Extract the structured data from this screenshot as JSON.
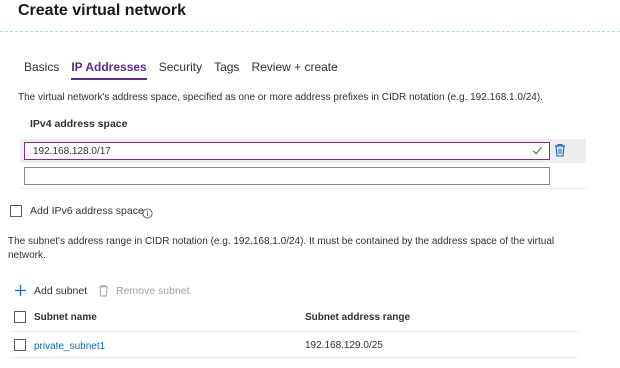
{
  "header": {
    "title": "Create virtual network"
  },
  "tabs": [
    {
      "label": "Basics",
      "active": false
    },
    {
      "label": "IP Addresses",
      "active": true
    },
    {
      "label": "Security",
      "active": false
    },
    {
      "label": "Tags",
      "active": false
    },
    {
      "label": "Review + create",
      "active": false
    }
  ],
  "address_space": {
    "description": "The virtual network's address space, specified as one or more address prefixes in CIDR notation (e.g. 192.168.1.0/24).",
    "ipv4_label": "IPv4 address space",
    "entries": [
      {
        "value": "192.168.128.0/17",
        "valid": true
      },
      {
        "value": ""
      }
    ],
    "valid_icon": "checkmark-icon",
    "delete_icon": "trash-icon"
  },
  "ipv6": {
    "label": "Add IPv6 address space",
    "checked": false,
    "info_icon": "info-icon"
  },
  "subnets": {
    "description_line1": "The subnet's address range in CIDR notation (e.g. 192.168.1.0/24). It must be contained by the address space of the virtual",
    "description_line2": "network.",
    "add_label": "Add subnet",
    "remove_label": "Remove subnet",
    "columns": [
      "Subnet name",
      "Subnet address range"
    ],
    "rows": [
      {
        "name": "private_subnet1",
        "range": "192.168.129.0/25"
      }
    ]
  },
  "colors": {
    "accent": "#5c2d91",
    "link": "#0b6cbd",
    "valid": "#3a9a3a"
  }
}
